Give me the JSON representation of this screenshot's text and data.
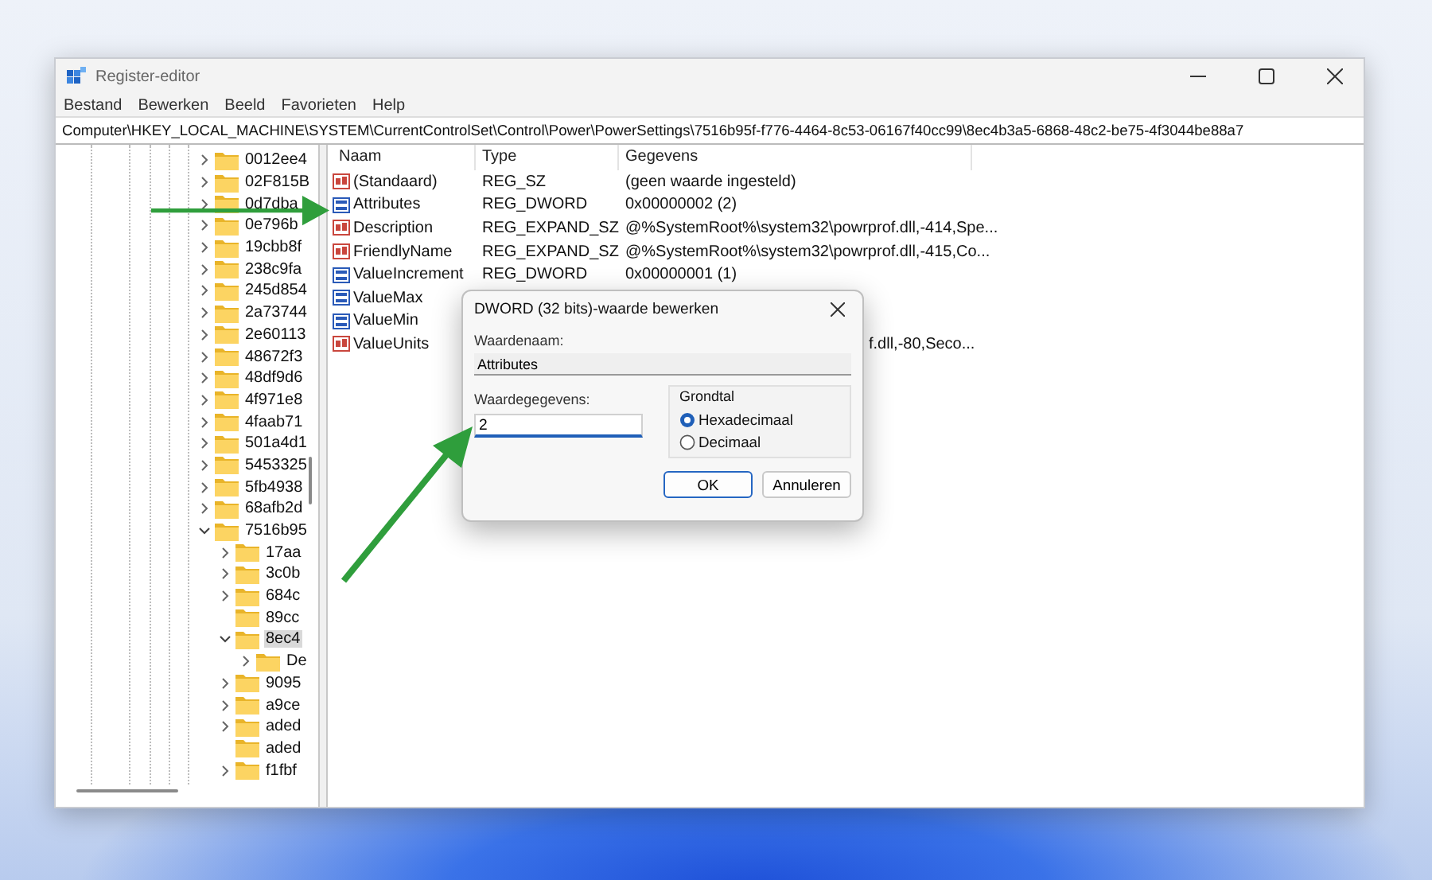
{
  "window": {
    "title": "Register-editor"
  },
  "menu": [
    "Bestand",
    "Bewerken",
    "Beeld",
    "Favorieten",
    "Help"
  ],
  "address": "Computer\\HKEY_LOCAL_MACHINE\\SYSTEM\\CurrentControlSet\\Control\\Power\\PowerSettings\\7516b95f-f776-4464-8c53-06167f40cc99\\8ec4b3a5-6868-48c2-be75-4f3044be88a7",
  "tree": [
    {
      "label": "0012ee4",
      "kind": "branch",
      "expanded": false,
      "selected": false
    },
    {
      "label": "02F815B",
      "kind": "branch",
      "expanded": false,
      "selected": false
    },
    {
      "label": "0d7dba",
      "kind": "branch",
      "expanded": false,
      "selected": false
    },
    {
      "label": "0e796b",
      "kind": "branch",
      "expanded": false,
      "selected": false
    },
    {
      "label": "19cbb8f",
      "kind": "branch",
      "expanded": false,
      "selected": false
    },
    {
      "label": "238c9fa",
      "kind": "branch",
      "expanded": false,
      "selected": false
    },
    {
      "label": "245d854",
      "kind": "branch",
      "expanded": false,
      "selected": false
    },
    {
      "label": "2a73744",
      "kind": "branch",
      "expanded": false,
      "selected": false
    },
    {
      "label": "2e60113",
      "kind": "branch",
      "expanded": false,
      "selected": false
    },
    {
      "label": "48672f3",
      "kind": "branch",
      "expanded": false,
      "selected": false
    },
    {
      "label": "48df9d6",
      "kind": "branch",
      "expanded": false,
      "selected": false
    },
    {
      "label": "4f971e8",
      "kind": "branch",
      "expanded": false,
      "selected": false
    },
    {
      "label": "4faab71",
      "kind": "branch",
      "expanded": false,
      "selected": false
    },
    {
      "label": "501a4d1",
      "kind": "branch",
      "expanded": false,
      "selected": false
    },
    {
      "label": "5453325",
      "kind": "branch",
      "expanded": false,
      "selected": false
    },
    {
      "label": "5fb4938",
      "kind": "branch",
      "expanded": false,
      "selected": false
    },
    {
      "label": "68afb2d",
      "kind": "branch",
      "expanded": false,
      "selected": false
    },
    {
      "label": "7516b95",
      "kind": "branch",
      "expanded": true,
      "selected": false,
      "children": [
        {
          "label": "17aa",
          "kind": "branch",
          "expanded": false,
          "selected": false
        },
        {
          "label": "3c0b",
          "kind": "branch",
          "expanded": false,
          "selected": false
        },
        {
          "label": "684c",
          "kind": "branch",
          "expanded": false,
          "selected": false
        },
        {
          "label": "89cc",
          "kind": "leaf",
          "selected": false
        },
        {
          "label": "8ec4",
          "kind": "branch",
          "expanded": true,
          "selected": true,
          "children": [
            {
              "label": "De",
              "kind": "branch",
              "expanded": false,
              "selected": false
            }
          ]
        },
        {
          "label": "9095",
          "kind": "branch",
          "expanded": false,
          "selected": false
        },
        {
          "label": "a9ce",
          "kind": "branch",
          "expanded": false,
          "selected": false
        },
        {
          "label": "aded",
          "kind": "branch",
          "expanded": false,
          "selected": false
        },
        {
          "label": "aded",
          "kind": "leaf",
          "selected": false
        },
        {
          "label": "f1fbf",
          "kind": "branch",
          "expanded": false,
          "selected": false
        }
      ]
    }
  ],
  "columns": [
    "Naam",
    "Type",
    "Gegevens"
  ],
  "values": [
    {
      "kind": "string",
      "name": "(Standaard)",
      "type": "REG_SZ",
      "data": "(geen waarde ingesteld)"
    },
    {
      "kind": "dword",
      "name": "Attributes",
      "type": "REG_DWORD",
      "data": "0x00000002 (2)"
    },
    {
      "kind": "string",
      "name": "Description",
      "type": "REG_EXPAND_SZ",
      "data": "@%SystemRoot%\\system32\\powrprof.dll,-414,Spe..."
    },
    {
      "kind": "string",
      "name": "FriendlyName",
      "type": "REG_EXPAND_SZ",
      "data": "@%SystemRoot%\\system32\\powrprof.dll,-415,Co..."
    },
    {
      "kind": "dword",
      "name": "ValueIncrement",
      "type": "REG_DWORD",
      "data": "0x00000001 (1)"
    },
    {
      "kind": "dword",
      "name": "ValueMax"
    },
    {
      "kind": "dword",
      "name": "ValueMin"
    },
    {
      "kind": "string",
      "name": "ValueUnits",
      "data_tail": "f.dll,-80,Seco..."
    }
  ],
  "dialog": {
    "title": "DWORD (32 bits)-waarde bewerken",
    "name_label": "Waardenaam:",
    "name_value": "Attributes",
    "data_label": "Waardegegevens:",
    "data_value": "2",
    "base_group": "Grondtal",
    "base_options": [
      {
        "label": "Hexadecimaal",
        "selected": true
      },
      {
        "label": "Decimaal",
        "selected": false
      }
    ],
    "buttons": [
      {
        "label": "OK",
        "default": true
      },
      {
        "label": "Annuleren",
        "default": false
      }
    ]
  }
}
